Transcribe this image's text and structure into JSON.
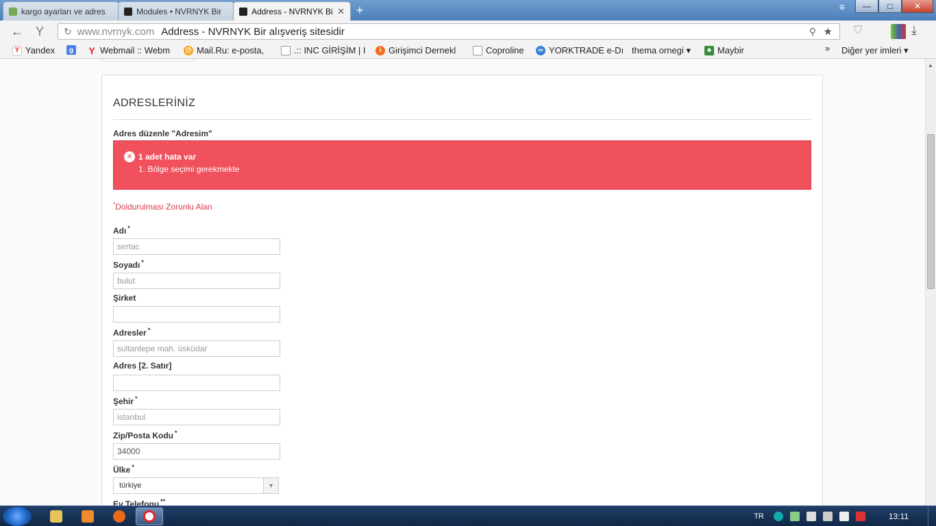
{
  "browser": {
    "tabs": [
      {
        "label": "kargo ayarları ve adres",
        "active": false
      },
      {
        "label": "Modules • NVRNYK Bir",
        "active": false
      },
      {
        "label": "Address - NVRNYK Bir",
        "active": true
      }
    ],
    "new_tab": "+",
    "menu": "≡",
    "window_buttons": {
      "minimize": "—",
      "maximize": "□",
      "close": "✕"
    },
    "back": "←",
    "y_logo": "Y",
    "url_domain": "www.nvrnyk.com",
    "url_title": "Address - NVRNYK Bir alışveriş sitesidir",
    "bookmarks": [
      {
        "label": "Yandex",
        "icon": "yandex-icon"
      },
      {
        "label": "",
        "icon": "google-icon"
      },
      {
        "label": "Webmail :: Webm",
        "icon": "yandex-y-icon"
      },
      {
        "label": "Mail.Ru: e-posta,",
        "icon": "mailru-icon"
      },
      {
        "label": ".:: INC GİRİŞİM | I",
        "icon": "page-icon"
      },
      {
        "label": "Girişimci Dernekl",
        "icon": "orange-circle-icon"
      },
      {
        "label": "Coproline",
        "icon": "page-icon"
      },
      {
        "label": "YORKTRADE e-Dı",
        "icon": "butterfly-icon"
      },
      {
        "label": "thema ornegi ▾",
        "icon": ""
      },
      {
        "label": "Maybir",
        "icon": "tree-icon"
      }
    ],
    "overflow": "»",
    "other_bookmarks": "Diğer yer imleri ▾"
  },
  "page": {
    "heading": "ADRESLERİNİZ",
    "subheading": "Adres düzenle \"Adresim\"",
    "error": {
      "icon": "✕",
      "title": "1 adet hata var",
      "items": [
        "1.  Bölge seçimi gerekmekte"
      ]
    },
    "required_mark": "*",
    "required_note": "Doldurulması Zorunlu Alan",
    "fields": [
      {
        "label": "Adı",
        "mark": "*",
        "value": "sertac"
      },
      {
        "label": "Soyadı",
        "mark": "*",
        "value": "bulut"
      },
      {
        "label": "Şirket",
        "mark": "",
        "value": ""
      },
      {
        "label": "Adresler",
        "mark": "*",
        "value": "sultantepe mah. üsküdar"
      },
      {
        "label": "Adres [2. Satır]",
        "mark": "",
        "value": ""
      },
      {
        "label": "Şehir",
        "mark": "*",
        "value": "istanbul"
      },
      {
        "label": "Zip/Posta Kodu",
        "mark": "*",
        "value": "34000"
      }
    ],
    "country": {
      "label": "Ülke",
      "mark": "*",
      "value": "türkiye"
    },
    "phone": {
      "label": "Ev Telefonu",
      "mark": "**"
    }
  },
  "taskbar": {
    "lang": "TR",
    "clock": "13:11"
  }
}
